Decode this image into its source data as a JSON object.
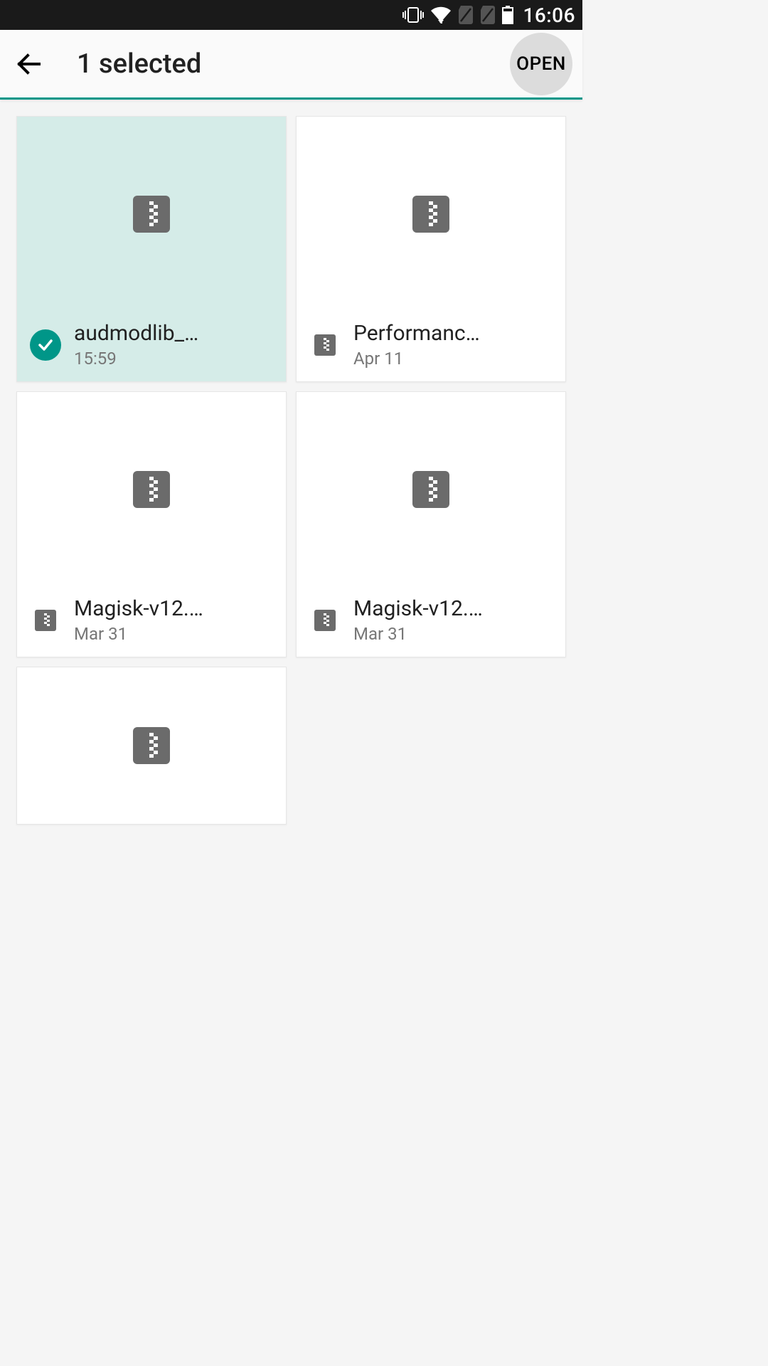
{
  "status_bar": {
    "time": "16:06"
  },
  "app_bar": {
    "title": "1 selected",
    "open_label": "OPEN"
  },
  "files": [
    {
      "name": "audmodlib_…",
      "date": "15:59",
      "selected": true
    },
    {
      "name": "Performanc…",
      "date": "Apr 11",
      "selected": false
    },
    {
      "name": "Magisk-v12.…",
      "date": "Mar 31",
      "selected": false
    },
    {
      "name": "Magisk-v12.…",
      "date": "Mar 31",
      "selected": false
    },
    {
      "name": "",
      "date": "",
      "selected": false
    }
  ]
}
